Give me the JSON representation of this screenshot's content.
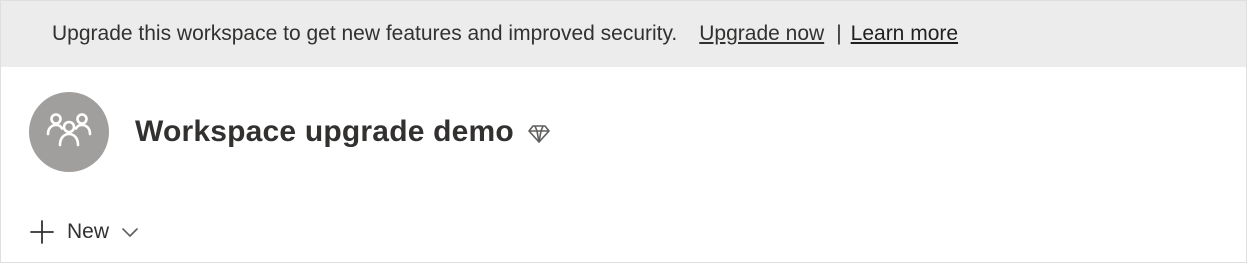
{
  "banner": {
    "message": "Upgrade this workspace to get new features and improved security.",
    "upgrade_link": "Upgrade now",
    "separator": "|",
    "learn_link": "Learn more"
  },
  "workspace": {
    "title": "Workspace upgrade demo",
    "avatar_icon": "people-group-icon",
    "premium_icon": "diamond-icon"
  },
  "toolbar": {
    "new_label": "New",
    "new_icon": "plus-icon",
    "dropdown_icon": "chevron-down-icon"
  },
  "colors": {
    "banner_bg": "#ececec",
    "avatar_bg": "#a19f9d",
    "text": "#323130"
  }
}
